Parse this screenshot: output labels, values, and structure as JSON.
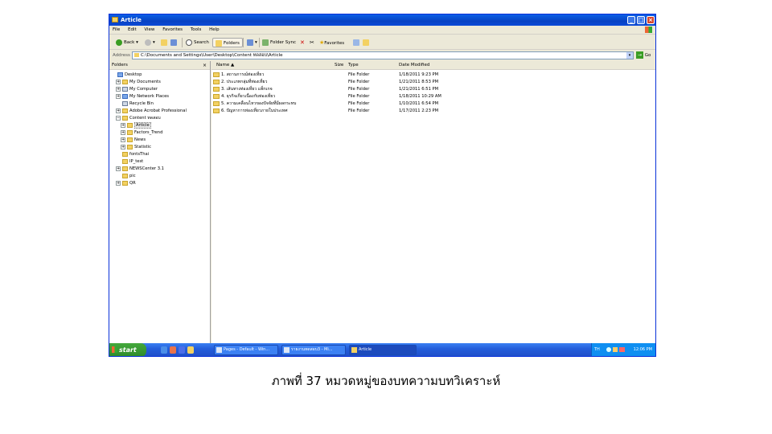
{
  "window": {
    "title": "Article",
    "controls": {
      "minimize": "_",
      "maximize": "□",
      "close": "×"
    }
  },
  "menu": [
    "File",
    "Edit",
    "View",
    "Favorites",
    "Tools",
    "Help"
  ],
  "toolbar": {
    "back": "Back",
    "search": "Search",
    "folders": "Folders",
    "folder_sync": "Folder Sync",
    "favorites": "Favorites"
  },
  "address": {
    "label": "Address",
    "path": "C:\\Documents and Settings\\User\\Desktop\\Content ทดสอบ\\Article",
    "go": "Go"
  },
  "folders_pane": {
    "title": "Folders",
    "close": "×",
    "tree": [
      {
        "label": "Desktop",
        "expander": "",
        "icon": "desktop-icon"
      },
      {
        "label": "My Documents",
        "expander": "+",
        "icon": "folder-icon"
      },
      {
        "label": "My Computer",
        "expander": "+",
        "icon": "computer-icon"
      },
      {
        "label": "My Network Places",
        "expander": "+",
        "icon": "network-icon"
      },
      {
        "label": "Recycle Bin",
        "expander": "",
        "icon": "recycle-bin-icon"
      },
      {
        "label": "Adobe Acrobat Professional",
        "expander": "+",
        "icon": "folder-icon"
      },
      {
        "label": "Content ทดสอบ",
        "expander": "−",
        "icon": "folder-icon"
      },
      {
        "label": "Article",
        "expander": "+",
        "icon": "folder-icon",
        "selected": true
      },
      {
        "label": "Factors_Trend",
        "expander": "+",
        "icon": "folder-icon"
      },
      {
        "label": "News",
        "expander": "+",
        "icon": "folder-icon"
      },
      {
        "label": "Statistic",
        "expander": "+",
        "icon": "folder-icon"
      },
      {
        "label": "fontsThai",
        "expander": "",
        "icon": "folder-icon"
      },
      {
        "label": "IP_test",
        "expander": "",
        "icon": "folder-icon"
      },
      {
        "label": "NEWSCenter 3.1",
        "expander": "+",
        "icon": "folder-icon"
      },
      {
        "label": "pic",
        "expander": "",
        "icon": "folder-icon"
      },
      {
        "label": "QR",
        "expander": "+",
        "icon": "folder-icon"
      }
    ]
  },
  "list": {
    "columns": {
      "name": "Name ▲",
      "size": "Size",
      "type": "Type",
      "date": "Date Modified"
    },
    "rows": [
      {
        "name": "1. สถานการณ์ท่องเที่ยว",
        "size": "",
        "type": "File Folder",
        "date": "1/18/2011 9:23 PM"
      },
      {
        "name": "2. ประเภทกลุ่มที่ท่องเที่ยว",
        "size": "",
        "type": "File Folder",
        "date": "1/21/2011 8:53 PM"
      },
      {
        "name": "3. เส้นทางท่องเที่ยว แพ็กเกจ",
        "size": "",
        "type": "File Folder",
        "date": "1/21/2011 6:51 PM"
      },
      {
        "name": "4. ธุรกิจเกี่ยวเนื่องกับท่องเที่ยว",
        "size": "",
        "type": "File Folder",
        "date": "1/18/2011 10:29 AM"
      },
      {
        "name": "5. ความเคลื่อนไหวของปัจจัยที่มีผลกระทบ",
        "size": "",
        "type": "File Folder",
        "date": "1/10/2011 6:54 PM"
      },
      {
        "name": "6. ปัญหาการท่องเที่ยวภายในประเทศ",
        "size": "",
        "type": "File Folder",
        "date": "1/17/2011 2:23 PM"
      }
    ]
  },
  "taskbar": {
    "start": "start",
    "tasks": [
      {
        "label": "Pages - Default - Win...",
        "active": false
      },
      {
        "label": "รายงานทดสอบ3 - Mi...",
        "active": false
      },
      {
        "label": "Article",
        "active": true
      }
    ],
    "language": "TH",
    "clock": "12:06 PM"
  },
  "caption": "ภาพที่ 37 หมวดหมู่ของบทความบทวิเคราะห์",
  "colors": {
    "titlebar": "#0a5fe6",
    "taskbar": "#245edb",
    "start_button": "#2e8b2a",
    "window_bg": "#ece9d8",
    "folder_yellow": "#f3d162"
  }
}
